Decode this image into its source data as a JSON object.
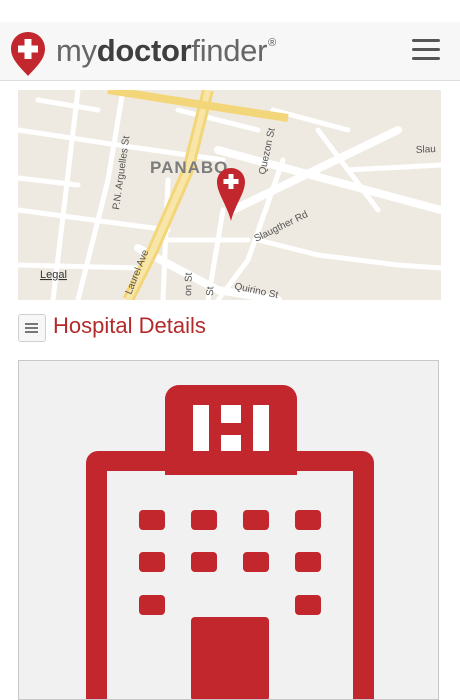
{
  "header": {
    "brand_my": "my",
    "brand_doctor": "doctor",
    "brand_finder": "finder",
    "brand_registered": "®"
  },
  "map": {
    "place_label": "PANABO",
    "legal_label": "Legal",
    "streets": {
      "quezon": "Quezon St",
      "arguelles": "P.N. Arguelles St",
      "slaughter": "Slaugther Rd",
      "laurel": "Laurel Ave",
      "quirino": "Quirino St",
      "slau": "Slau",
      "on_st": "on St",
      "st": "St"
    }
  },
  "section": {
    "title": "Hospital Details"
  },
  "icons": {
    "logo": "plus-pin-icon",
    "menu": "hamburger-icon",
    "marker": "map-marker-icon",
    "list": "list-icon",
    "hospital": "hospital-building-icon"
  },
  "colors": {
    "accent": "#c1272d",
    "title": "#b32a2a",
    "header_bg": "#f7f7f7"
  }
}
